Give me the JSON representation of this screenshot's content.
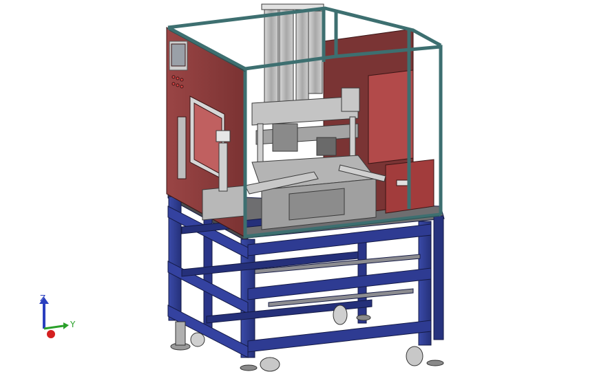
{
  "viewport": {
    "background": "#ffffff",
    "frame_color": "#2f3f9a",
    "panel_color": "#8a3a3a",
    "guard_color": "#5a8a8a",
    "mechanism_color": "#b8b8b8"
  },
  "triad": {
    "z_label": "Z",
    "y_label": "Y",
    "z_color": "#2a3fbf",
    "y_color": "#2aa02a",
    "x_color": "#d42020"
  }
}
